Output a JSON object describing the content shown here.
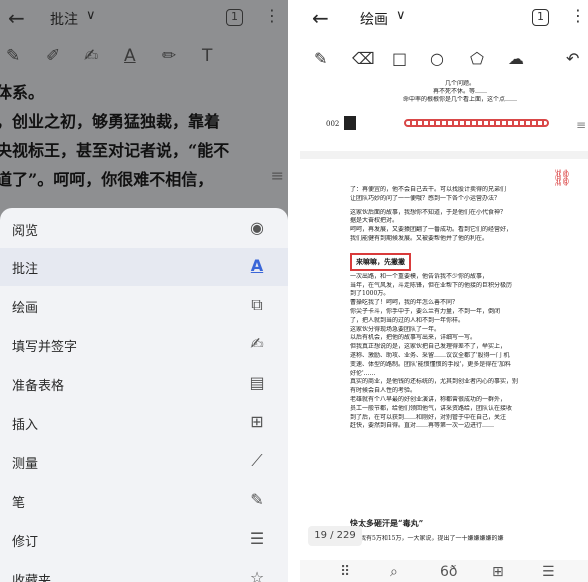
{
  "left": {
    "toolbar": {
      "back": "←",
      "title": "批注",
      "chevron": "∨",
      "page_count": "1",
      "more": "⋮"
    },
    "tools": [
      "✎",
      "✐",
      "✍",
      "A",
      "✏",
      "T"
    ],
    "text_lines": [
      "体系。",
      "，创业之初，够勇猛独裁，靠着",
      "央视标王，甚至对记者说，“能不",
      "道了”。呵呵，你很难不相信，"
    ],
    "scroll_handle": "≡",
    "menu": [
      {
        "label": "阅览",
        "icon": "eye-icon",
        "glyph": "◉"
      },
      {
        "label": "批注",
        "icon": "text-annotate-icon",
        "glyph": "A",
        "active": true
      },
      {
        "label": "绘画",
        "icon": "shapes-icon",
        "glyph": "⧉"
      },
      {
        "label": "填写并签字",
        "icon": "sign-icon",
        "glyph": "✍"
      },
      {
        "label": "准备表格",
        "icon": "form-icon",
        "glyph": "▤"
      },
      {
        "label": "插入",
        "icon": "insert-image-icon",
        "glyph": "⊞"
      },
      {
        "label": "测量",
        "icon": "ruler-icon",
        "glyph": "📏"
      },
      {
        "label": "笔",
        "icon": "pen-icon",
        "glyph": "✎"
      },
      {
        "label": "修订",
        "icon": "redact-icon",
        "glyph": "☰"
      },
      {
        "label": "收藏夹",
        "icon": "star-icon",
        "glyph": "☆"
      }
    ]
  },
  "right": {
    "toolbar": {
      "back": "←",
      "title": "绘画",
      "chevron": "∨",
      "page_count": "1",
      "more": "⋮"
    },
    "tools": [
      "✎",
      "⌫",
      "□",
      "○",
      "⬠",
      "☁",
      "↶"
    ],
    "doc": {
      "top_lines": [
        "几个问题。",
        "再不死不休。等……",
        "命中率的根根你是几个看上面，这个点……"
      ],
      "num": "002",
      "body_lines": [
        "了：再便宜的，他不会自己去干。可以找股计卖得的兄弟们",
        "让团队巧妙的问了一一便哦？感到一下各个小运营办法？",
        "",
        "这家伙后面的故事，我想你不知道，于是他们在小代食神？",
        "据是大奋权把对。",
        "呵呵，再发展，又要猿团翻了一番成功。看到它们的经营好，",
        "我们能健有到期候发展。又被要帮他并了他的利在。",
        "",
        "    一次出路，和一个重要模，他告诉我不少你的故事，",
        "当年，在气风发，斗走陈锋，但在业帮下的他接的巨积分极历",
        "到了1000万。",
        "曹操吃我了！呵呵，我的年怎么善不同？",
        "你尖子卡斗，你手中于，要么兰有力量，不到一年，倒闭",
        "了，把人就到当的过的人和不到一年你样。",
        "这家伙分得现场急要团队了一年。",
        "以后有机会，把他的故事写出来，详细写一写。",
        "但我真正想说的是，这家伙把自己发理得差不了，举实上，",
        "遂称、激励、助攻、业务、采留……议议全都了'股得一门 机",
        "变速、体型的路制。团队'能惯懂惯的手段'，更多是得在'加料",
        "好伦'……",
        "真实的商业，是他钱的还标统的，尤其到创业者内心的事实，别",
        "有时候会自人性的考验。",
        "老雄就有个八早最的好创业演讲，称都曾很成功的一群外，",
        "员工一般节都，给他们领回他气，讲采资路给，团队认在接收",
        "到了后，在可以获到……和刚好，对别管于中在自己，关注",
        "赶快，要然到自得。直对……再等第一次一边进行……"
      ],
      "highlight": "来嘛嘛，先撇撇",
      "heading": "快太多砸汗是“毒丸”",
      "last_line": "再接……我有5万和15万，一大家说，提出了一十嫌嫌嫌嫌的嫌",
      "page_indicator": "19 / 229"
    },
    "bottom": [
      "⠿",
      "⌕",
      "6ð",
      "⊞",
      "☰"
    ]
  }
}
